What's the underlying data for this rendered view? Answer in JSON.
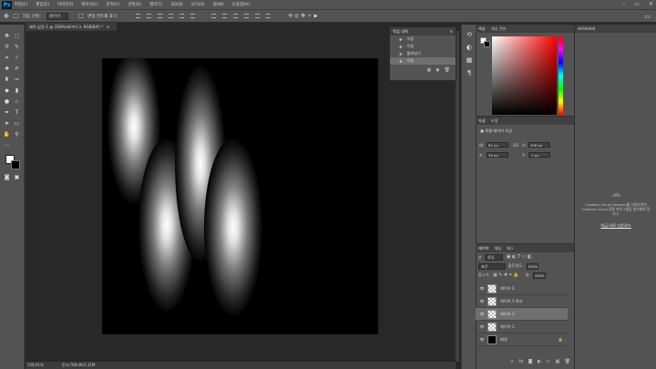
{
  "app": {
    "logo": "Ps"
  },
  "menu": [
    "파일(F)",
    "편집(E)",
    "이미지(I)",
    "레이어(L)",
    "문자(Y)",
    "선택(S)",
    "필터(T)",
    "3D(D)",
    "보기(V)",
    "창(W)",
    "도움말(H)"
  ],
  "window_controls": [
    "–",
    "▭",
    "✕"
  ],
  "options_bar": {
    "auto_select_label": "자동 선택 :",
    "auto_select_value": "레이어",
    "transform_label": "변형 컨트롤 표시"
  },
  "document_tab": {
    "title": "제목 없음-1 @ 158%(레이어 3, RGB/8#) *",
    "close": "✕"
  },
  "status": {
    "zoom": "158.01%",
    "doc_size": "문서:768.0K/3.31M"
  },
  "history": {
    "tab": "작업 내역",
    "items": [
      {
        "label": "이동"
      },
      {
        "label": "이동"
      },
      {
        "label": "붙여넣기"
      },
      {
        "label": "이동"
      }
    ]
  },
  "color_panel": {
    "tabs": [
      "색상",
      "색상 견본"
    ]
  },
  "properties": {
    "tabs": [
      "속성",
      "조정"
    ],
    "title": "픽셀 레이어 속성",
    "w_label": "W:",
    "w_value": "81 px",
    "h_label": "H:",
    "h_value": "438 px",
    "x_label": "X:",
    "x_value": "34 px",
    "y_label": "Y:",
    "y_value": "-7 px",
    "link": "GO"
  },
  "layers_panel": {
    "tabs": [
      "레이어",
      "채널",
      "패스"
    ],
    "filter": "종류",
    "blend_mode": "표준",
    "opacity_label": "불투명도:",
    "opacity_value": "100%",
    "lock_label": "잠그기:",
    "fill_label": "칠:",
    "fill_value": "100%",
    "layers": [
      {
        "name": "레이어 2",
        "selected": false,
        "bg": false
      },
      {
        "name": "레이어 1 복사",
        "selected": false,
        "bg": false
      },
      {
        "name": "레이어 3",
        "selected": true,
        "bg": false
      },
      {
        "name": "레이어 1",
        "selected": false,
        "bg": false
      },
      {
        "name": "배경",
        "selected": false,
        "bg": true
      }
    ]
  },
  "libraries": {
    "tab": "라이브러리",
    "message": "Creative Cloud Libraries를 사용하려면 Creative Cloud 응용 프로그램을 설치해야 합니다.",
    "link": "지금 바로 다운로드"
  },
  "colors": {
    "accent": "#31a8ff",
    "panel": "#535353",
    "canvas_bg": "#282828",
    "selected_row": "#6f6f6f"
  }
}
